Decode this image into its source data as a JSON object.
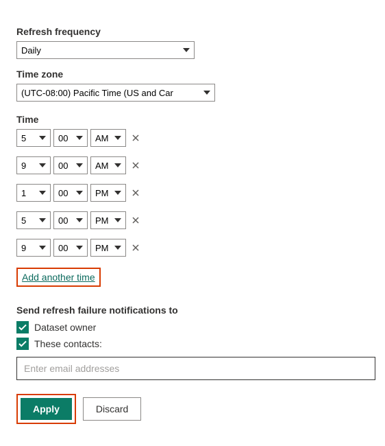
{
  "refresh_frequency": {
    "label": "Refresh frequency",
    "value": "Daily"
  },
  "time_zone": {
    "label": "Time zone",
    "value": "(UTC-08:00) Pacific Time (US and Car"
  },
  "time": {
    "label": "Time",
    "rows": [
      {
        "hour": "5",
        "minute": "00",
        "ampm": "AM"
      },
      {
        "hour": "9",
        "minute": "00",
        "ampm": "AM"
      },
      {
        "hour": "1",
        "minute": "00",
        "ampm": "PM"
      },
      {
        "hour": "5",
        "minute": "00",
        "ampm": "PM"
      },
      {
        "hour": "9",
        "minute": "00",
        "ampm": "PM"
      }
    ],
    "add_label": "Add another time"
  },
  "notifications": {
    "label": "Send refresh failure notifications to",
    "dataset_owner_label": "Dataset owner",
    "these_contacts_label": "These contacts:",
    "email_placeholder": "Enter email addresses"
  },
  "buttons": {
    "apply": "Apply",
    "discard": "Discard"
  }
}
